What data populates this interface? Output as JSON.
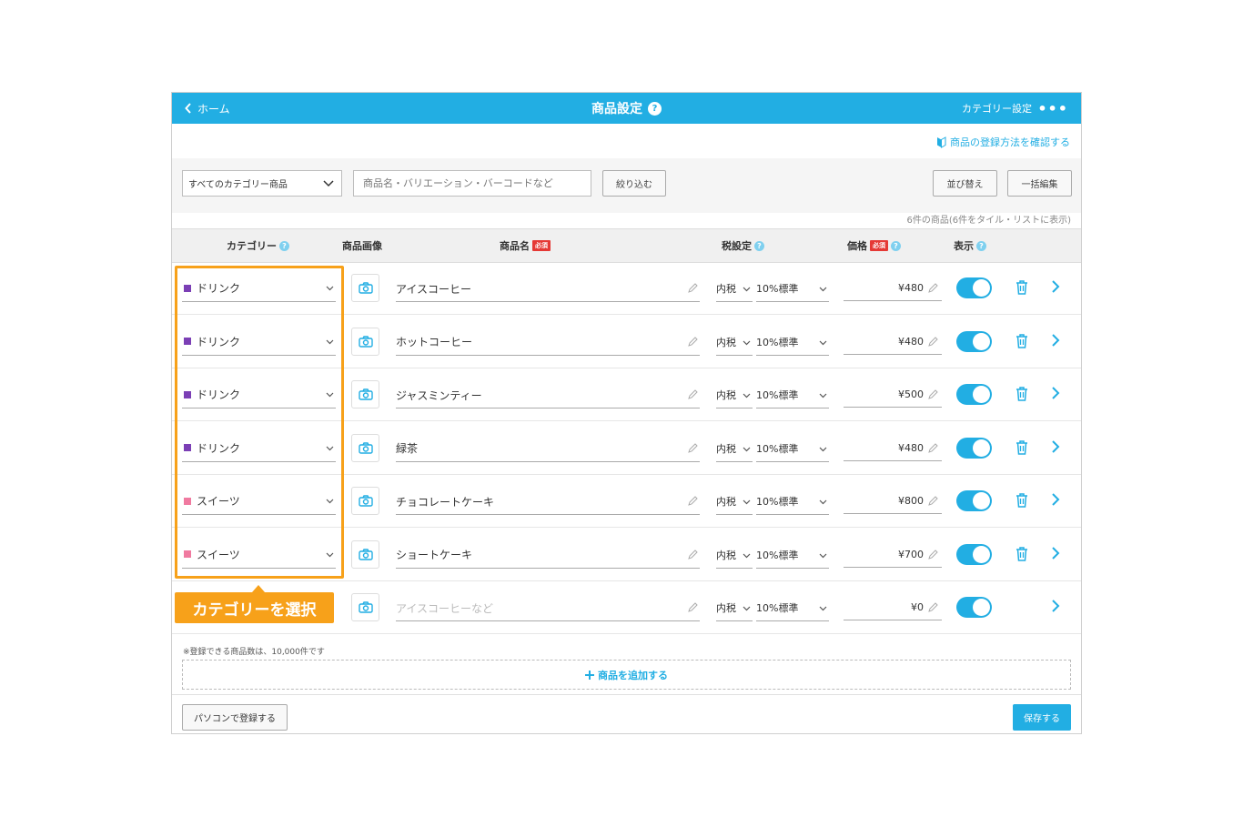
{
  "header": {
    "back_label": "ホーム",
    "title": "商品設定",
    "help_mark": "?",
    "category_settings": "カテゴリー設定",
    "more": "•••"
  },
  "guide_link": "商品の登録方法を確認する",
  "filter": {
    "category_select": "すべてのカテゴリー商品",
    "search_placeholder": "商品名・バリエーション・バーコードなど",
    "filter_button": "絞り込む",
    "sort_button": "並び替え",
    "bulk_edit_button": "一括編集"
  },
  "count_text": "6件の商品(6件をタイル・リストに表示)",
  "columns": {
    "category": "カテゴリー",
    "image": "商品画像",
    "name": "商品名",
    "tax": "税設定",
    "price": "価格",
    "display": "表示",
    "required": "必須",
    "help": "?"
  },
  "products": [
    {
      "category": "ドリンク",
      "category_color": "#7b3fb5",
      "name": "アイスコーヒー",
      "tax": "内税",
      "rate": "10%標準",
      "price": "¥480",
      "display": true
    },
    {
      "category": "ドリンク",
      "category_color": "#7b3fb5",
      "name": "ホットコーヒー",
      "tax": "内税",
      "rate": "10%標準",
      "price": "¥480",
      "display": true
    },
    {
      "category": "ドリンク",
      "category_color": "#7b3fb5",
      "name": "ジャスミンティー",
      "tax": "内税",
      "rate": "10%標準",
      "price": "¥500",
      "display": true
    },
    {
      "category": "ドリンク",
      "category_color": "#7b3fb5",
      "name": "緑茶",
      "tax": "内税",
      "rate": "10%標準",
      "price": "¥480",
      "display": true
    },
    {
      "category": "スイーツ",
      "category_color": "#f07aa0",
      "name": "チョコレートケーキ",
      "tax": "内税",
      "rate": "10%標準",
      "price": "¥800",
      "display": true
    },
    {
      "category": "スイーツ",
      "category_color": "#f07aa0",
      "name": "ショートケーキ",
      "tax": "内税",
      "rate": "10%標準",
      "price": "¥700",
      "display": true
    }
  ],
  "new_row": {
    "name_placeholder": "アイスコーヒーなど",
    "tax": "内税",
    "rate": "10%標準",
    "price": "¥0",
    "display": true
  },
  "callout": "カテゴリーを選択",
  "note": "※登録できる商品数は、10,000件です",
  "add_product": "商品を追加する",
  "footer": {
    "pc_register": "パソコンで登録する",
    "save": "保存する"
  },
  "colors": {
    "accent": "#22aee3",
    "highlight": "#f7a11a",
    "required_badge": "#e53935"
  }
}
